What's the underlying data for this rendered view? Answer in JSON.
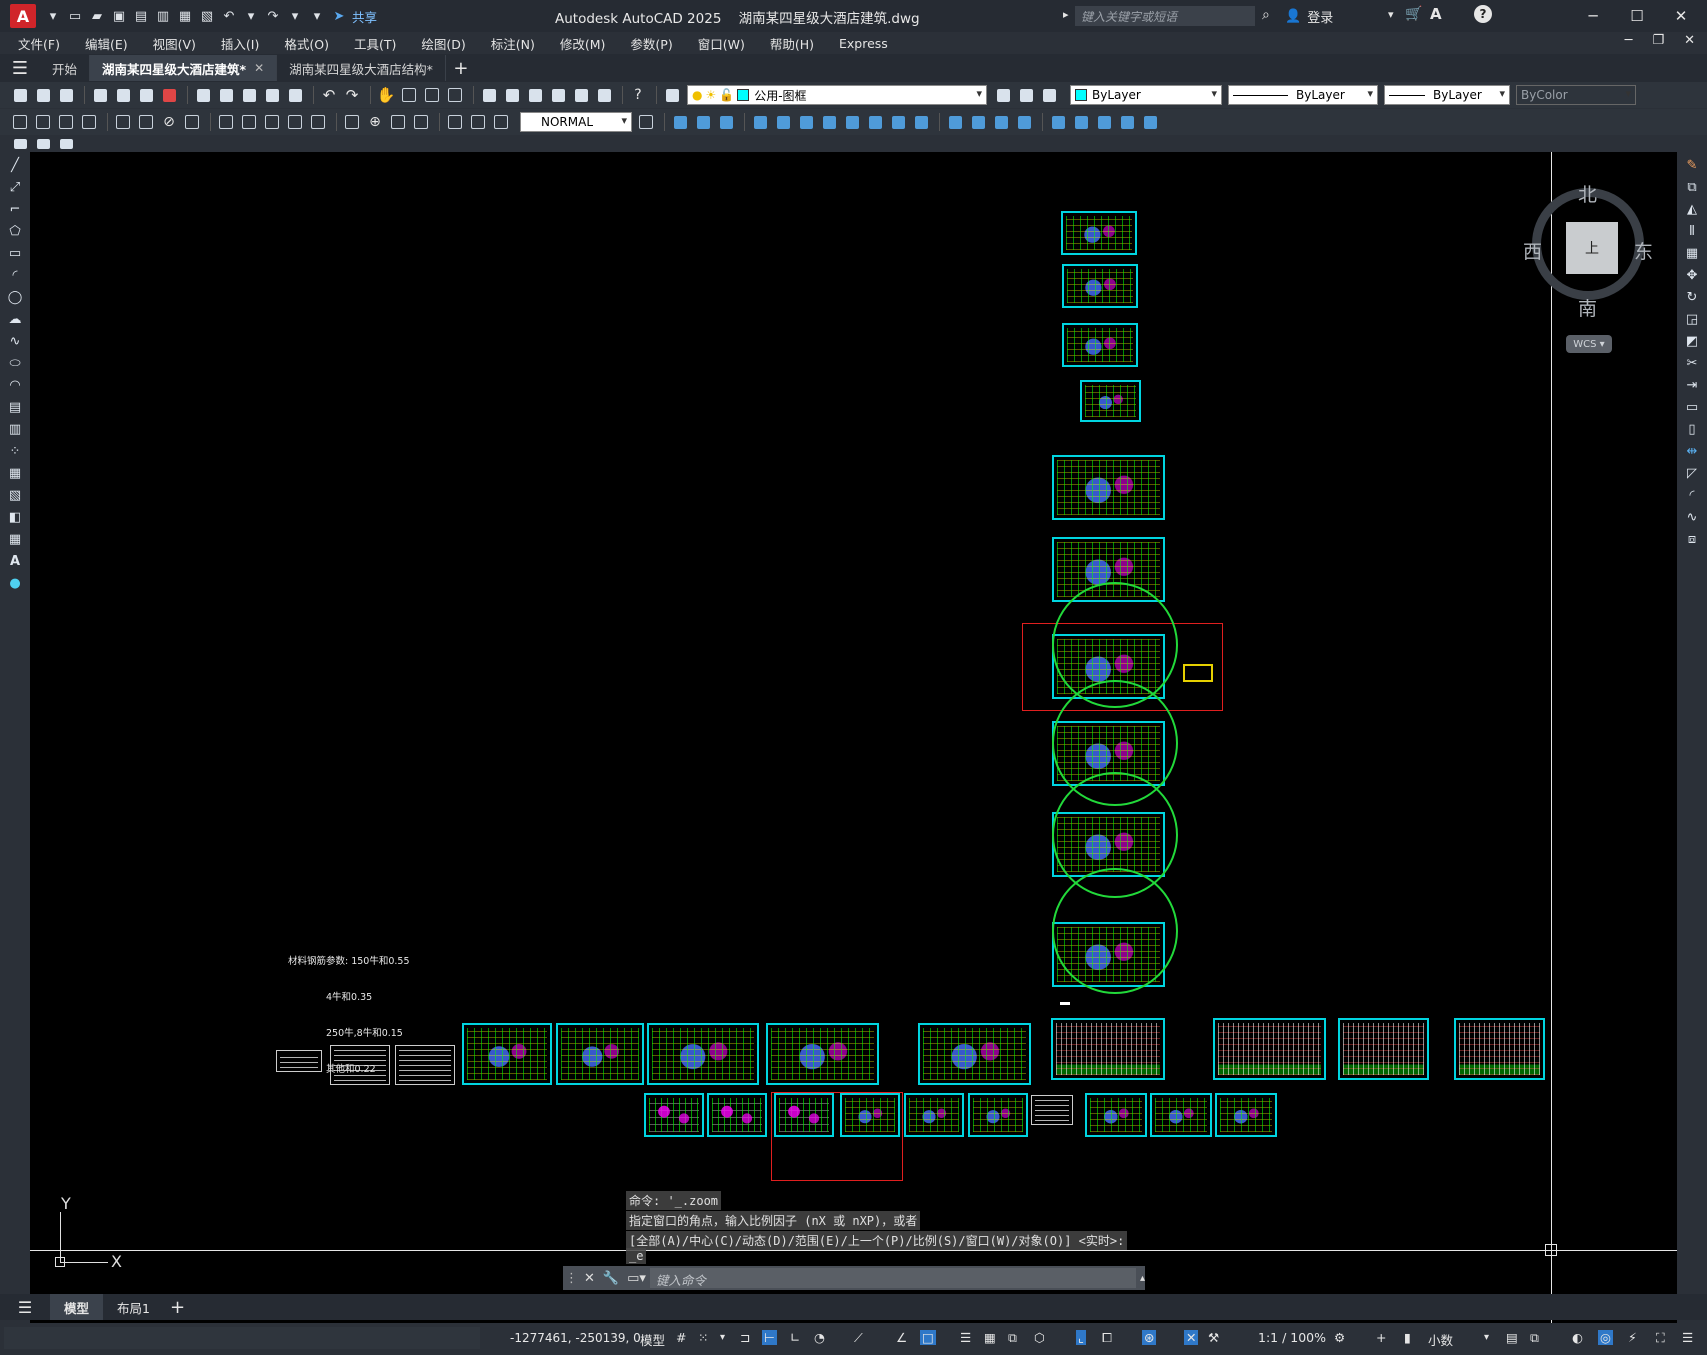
{
  "title": {
    "app": "Autodesk AutoCAD 2025",
    "file": "湖南某四星级大酒店建筑.dwg",
    "search_placeholder": "键入关键字或短语",
    "login": "登录",
    "share": "共享"
  },
  "menu": [
    "文件(F)",
    "编辑(E)",
    "视图(V)",
    "插入(I)",
    "格式(O)",
    "工具(T)",
    "绘图(D)",
    "标注(N)",
    "修改(M)",
    "参数(P)",
    "窗口(W)",
    "帮助(H)",
    "Express"
  ],
  "tabs": {
    "start": "开始",
    "active": "湖南某四星级大酒店建筑*",
    "second": "湖南某四星级大酒店结构*"
  },
  "toolbar": {
    "layer": "公用-图框",
    "color": "ByLayer",
    "linetype": "ByLayer",
    "lineweight": "ByLayer",
    "plotstyle": "ByColor",
    "dimstyle": "NORMAL"
  },
  "viewcube": {
    "north": "北",
    "south": "南",
    "east": "东",
    "west": "西",
    "face": "上",
    "wcs": "WCS"
  },
  "note_lines": [
    "材料钢筋参数: 150牛和0.55",
    "4牛和0.35",
    "250牛,8牛和0.15",
    "其他和0.22"
  ],
  "command": {
    "line1": "命令: '_.zoom",
    "line2": "指定窗口的角点，输入比例因子 (nX 或 nXP)，或者",
    "line3": "[全部(A)/中心(C)/动态(D)/范围(E)/上一个(P)/比例(S)/窗口(W)/对象(O)] <实时>:",
    "line4": "_e",
    "placeholder": "键入命令"
  },
  "ucs": {
    "x": "X",
    "y": "Y"
  },
  "layouts": {
    "model": "模型",
    "layout1": "布局1"
  },
  "status": {
    "coords": "-1277461, -250139, 0",
    "mode": "模型",
    "scale": "1:1 / 100%",
    "units": "小数"
  }
}
